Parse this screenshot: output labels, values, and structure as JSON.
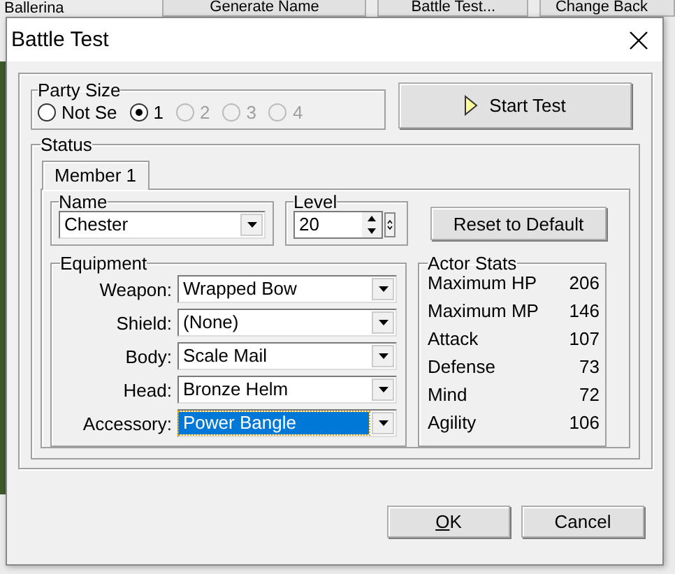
{
  "background": {
    "list_item": "Ballerina",
    "buttons": [
      "Generate Name",
      "Battle Test...",
      "Change Back"
    ]
  },
  "window": {
    "title": "Battle Test"
  },
  "party_size": {
    "label": "Party Size",
    "options": [
      {
        "label": "Not Se",
        "selected": false,
        "disabled": false
      },
      {
        "label": "1",
        "selected": true,
        "disabled": false
      },
      {
        "label": "2",
        "selected": false,
        "disabled": true
      },
      {
        "label": "3",
        "selected": false,
        "disabled": true
      },
      {
        "label": "4",
        "selected": false,
        "disabled": true
      }
    ]
  },
  "start_button": "Start Test",
  "status": {
    "label": "Status",
    "tabs": [
      {
        "label": "Member 1",
        "selected": true
      }
    ],
    "name": {
      "label": "Name",
      "value": "Chester"
    },
    "level": {
      "label": "Level",
      "value": "20"
    },
    "reset_button": "Reset to Default",
    "equipment": {
      "label": "Equipment",
      "slots": [
        {
          "label": "Weapon:",
          "value": "Wrapped Bow",
          "selected": false
        },
        {
          "label": "Shield:",
          "value": "(None)",
          "selected": false
        },
        {
          "label": "Body:",
          "value": "Scale Mail",
          "selected": false
        },
        {
          "label": "Head:",
          "value": "Bronze Helm",
          "selected": false
        },
        {
          "label": "Accessory:",
          "value": "Power Bangle",
          "selected": true
        }
      ]
    },
    "stats": {
      "label": "Actor Stats",
      "rows": [
        {
          "name": "Maximum HP",
          "value": "206"
        },
        {
          "name": "Maximum MP",
          "value": "146"
        },
        {
          "name": "Attack",
          "value": "107"
        },
        {
          "name": "Defense",
          "value": "73"
        },
        {
          "name": "Mind",
          "value": "72"
        },
        {
          "name": "Agility",
          "value": "106"
        }
      ]
    }
  },
  "buttons": [
    "OK",
    "Cancel"
  ]
}
